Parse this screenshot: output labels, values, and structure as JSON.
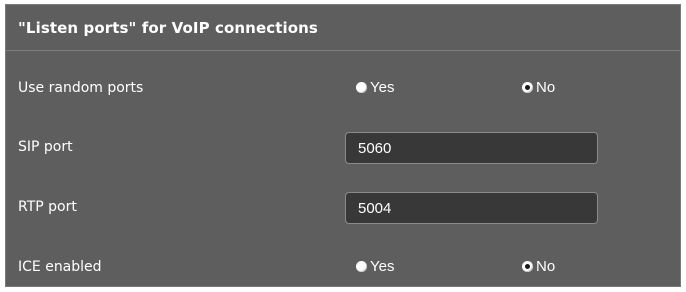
{
  "section": {
    "title": "\"Listen ports\" for VoIP connections"
  },
  "random_ports": {
    "label": "Use random ports",
    "options": [
      "Yes",
      "No"
    ],
    "selected": "No"
  },
  "sip_port": {
    "label": "SIP port",
    "value": "5060"
  },
  "rtp_port": {
    "label": "RTP port",
    "value": "5004"
  },
  "ice_enabled": {
    "label": "ICE enabled",
    "options": [
      "Yes",
      "No"
    ],
    "selected": "No"
  },
  "colors": {
    "panel_background": "#5e5e5e",
    "input_background": "#383838",
    "text": "#ffffff"
  }
}
